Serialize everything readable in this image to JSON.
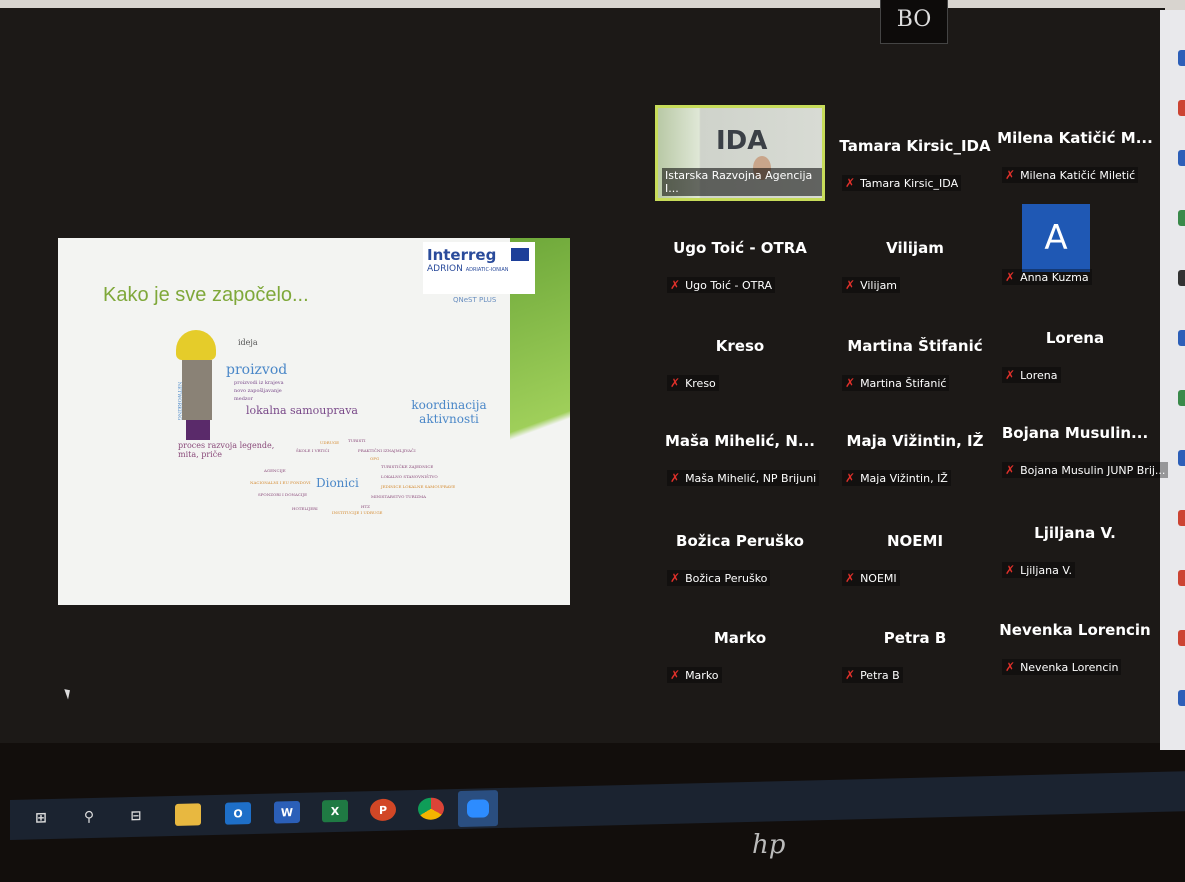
{
  "brand_badge": "BO",
  "slide": {
    "title": "Kako je sve započelo...",
    "logo_line1": "Interreg",
    "logo_line2": "ADRION",
    "logo_line3": "ADRIATIC-IONIAN",
    "project": "QNeST PLUS",
    "labels": {
      "ideja": "ideja",
      "proizvod": "proizvod",
      "proizvod_sub": [
        "proizvodi iz krajeva",
        "novo zapošljavanje",
        "medzor"
      ],
      "networking": "NETWORKING",
      "lokalna": "lokalna samouprava",
      "koordinacija": "koordinacija aktivnosti",
      "proces": "proces razvoja legende, mita, priče",
      "dionici": "Dionici",
      "stakeholders": [
        "ŠKOLE I VRTIĆI",
        "UDRUGE",
        "TURISTI",
        "PRAKTIČNI IZNAJMLJIVAČI",
        "OPG",
        "TURISTIČKE ZAJEDNICE",
        "LOKALNO STANOVNIŠTVO",
        "JEDINICE LOKALNE SAMOUPRAVE",
        "MINISTARSTVO TURIZMA",
        "HTZ",
        "INSTITUCIJE I UDRUGE",
        "HOTELIJERI",
        "SPONZORI I DONACIJE",
        "NACIONALNI I EU FONDOVI",
        "AGENCIJE"
      ]
    }
  },
  "participants": [
    {
      "big": "",
      "small": "Istarska Razvojna Agencija I...",
      "active": true,
      "video_logo": "ida"
    },
    {
      "big": "Tamara Kirsic_IDA",
      "small": "Tamara Kirsic_IDA"
    },
    {
      "big": "Milena Katičić M...",
      "small": "Milena Katičić Miletić"
    },
    {
      "big": "Ugo Toić - OTRA",
      "small": "Ugo Toić - OTRA"
    },
    {
      "big": "Vilijam",
      "small": "Vilijam"
    },
    {
      "big": "",
      "small": "Anna Kuzma",
      "avatar": "A"
    },
    {
      "big": "Kreso",
      "small": "Kreso"
    },
    {
      "big": "Martina Štifanić",
      "small": "Martina Štifanić"
    },
    {
      "big": "Lorena",
      "small": "Lorena"
    },
    {
      "big": "Maša Mihelić, N...",
      "small": "Maša Mihelić, NP Brijuni"
    },
    {
      "big": "Maja Vižintin, IŽ",
      "small": "Maja Vižintin, IŽ"
    },
    {
      "big": "Bojana Musulin...",
      "small": "Bojana Musulin JUNP Brij..."
    },
    {
      "big": "Božica Peruško",
      "small": "Božica Peruško"
    },
    {
      "big": "NOEMI",
      "small": "NOEMI"
    },
    {
      "big": "Ljiljana V.",
      "small": "Ljiljana V."
    },
    {
      "big": "Marko",
      "small": "Marko"
    },
    {
      "big": "Petra B",
      "small": "Petra B"
    },
    {
      "big": "Nevenka Lorencin",
      "small": "Nevenka Lorencin"
    }
  ],
  "icons": {
    "mute": "✗",
    "muted_icon": "microphone-muted-icon"
  },
  "taskbar": {
    "apps": [
      "start",
      "search",
      "task-view",
      "file-explorer",
      "outlook",
      "word",
      "excel",
      "powerpoint",
      "chrome",
      "zoom"
    ],
    "word": "W",
    "excel": "X",
    "ppt": "P",
    "outlook": "O"
  },
  "laptop_brand": "hp",
  "colors": {
    "active_border": "#c7dc5a",
    "mute_red": "#e0302a",
    "avatar_blue": "#1f58b4"
  }
}
